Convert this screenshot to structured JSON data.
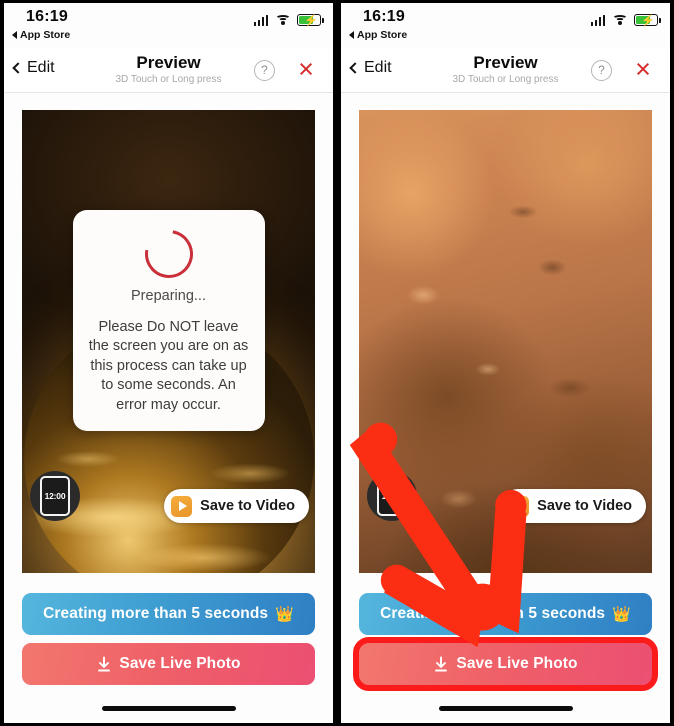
{
  "app": {
    "status_bar": {
      "time": "16:19",
      "back_label": "App Store",
      "icons": [
        "signal-bars-icon",
        "wifi-icon",
        "battery-charging-icon"
      ]
    },
    "nav_bar": {
      "back_label": "Edit",
      "title": "Preview",
      "subtitle": "3D Touch or Long press",
      "help_label": "?",
      "close_label": "×"
    },
    "dialog": {
      "status": "Preparing...",
      "body": "Please Do NOT leave the screen you are on as this process can take up to some seconds. An error may occur."
    },
    "overlays": {
      "thumbnail_time": "12:00",
      "save_to_video_label": "Save to Video"
    },
    "actions": {
      "upgrade_label": "Creating more than 5 seconds",
      "upgrade_emoji": "👑",
      "save_label": "Save Live Photo"
    },
    "colors": {
      "blue_button_start": "#55b6dd",
      "blue_button_end": "#2f7fc4",
      "red_button_start": "#f2776e",
      "red_button_end": "#ec4f72",
      "close_red": "#d42a2a",
      "highlight_red": "#fb1b1b",
      "spinner_red": "#c9303a",
      "battery_green": "#3ac13a",
      "pill_icon_orange": "#f5ae3c"
    }
  },
  "panels": [
    {
      "id": "left",
      "scene": "planet-night",
      "has_dialog": true,
      "has_arrow": false,
      "has_highlight": false
    },
    {
      "id": "right",
      "scene": "mars-surface",
      "has_dialog": false,
      "has_arrow": true,
      "has_highlight": true
    }
  ]
}
